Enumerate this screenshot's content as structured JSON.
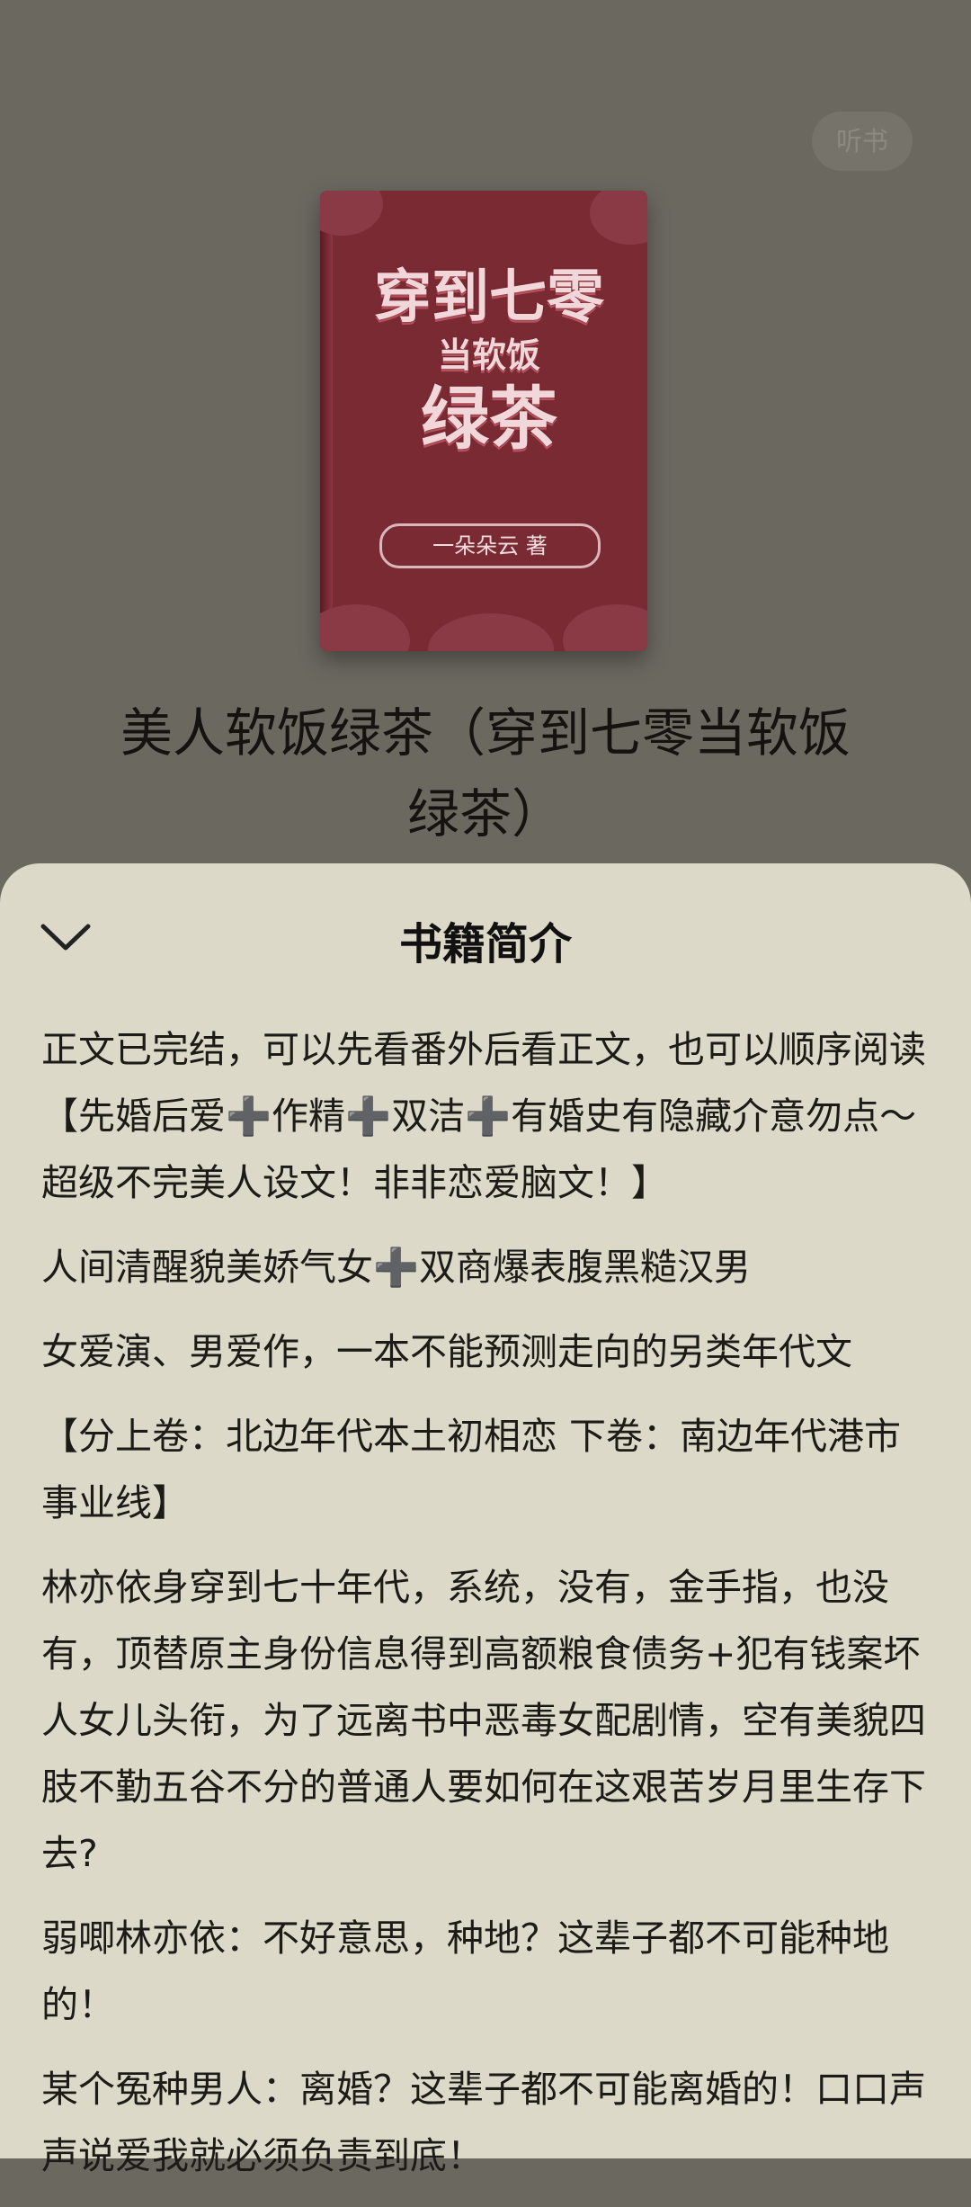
{
  "header": {
    "listen_label": "听书"
  },
  "cover": {
    "title_line1": "穿到七零",
    "title_line2": "当软饭",
    "title_line3": "绿茶",
    "author": "一朵朵云 著",
    "colors": {
      "base": "#7a2a33",
      "accent": "#f2d7da"
    }
  },
  "book": {
    "title": "美人软饭绿茶（穿到七零当软饭绿茶）"
  },
  "sheet": {
    "title": "书籍简介",
    "collapse_icon": "chevron-down-icon",
    "paragraphs": [
      "正文已完结，可以先看番外后看正文，也可以顺序阅读【先婚后爱➕作精➕双洁➕有婚史有隐藏介意勿点～超级不完美人设文！非非恋爱脑文！】",
      "人间清醒貌美娇气女➕双商爆表腹黑糙汉男",
      "女爱演、男爱作，一本不能预测走向的另类年代文",
      "【分上卷：北边年代本土初相恋 下卷：南边年代港市事业线】",
      "林亦依身穿到七十年代，系统，没有，金手指，也没有，顶替原主身份信息得到高额粮食债务+犯有钱案坏人女儿头衔，为了远离书中恶毒女配剧情，空有美貌四肢不勤五谷不分的普通人要如何在这艰苦岁月里生存下去?",
      "弱唧林亦依：不好意思，种地？这辈子都不可能种地的！",
      "某个冤种男人：离婚？这辈子都不可能离婚的！口口声声说爱我就必须负责到底！"
    ]
  }
}
